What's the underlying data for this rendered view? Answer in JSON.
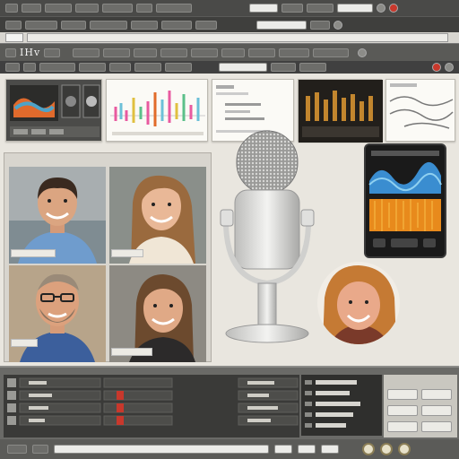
{
  "toolbar1": {
    "items": [
      "",
      "",
      "",
      "",
      "",
      "",
      ""
    ]
  },
  "toolbar4": {
    "brand": "IHv"
  },
  "colors": {
    "accent_red": "#c8382c",
    "panel_dark": "#3f3f3d",
    "wave_blue": "#3a8dd0",
    "wave_orange": "#e88a1c"
  },
  "icons": [
    "microphone-icon",
    "record-icon",
    "play-icon",
    "knob-icon"
  ]
}
